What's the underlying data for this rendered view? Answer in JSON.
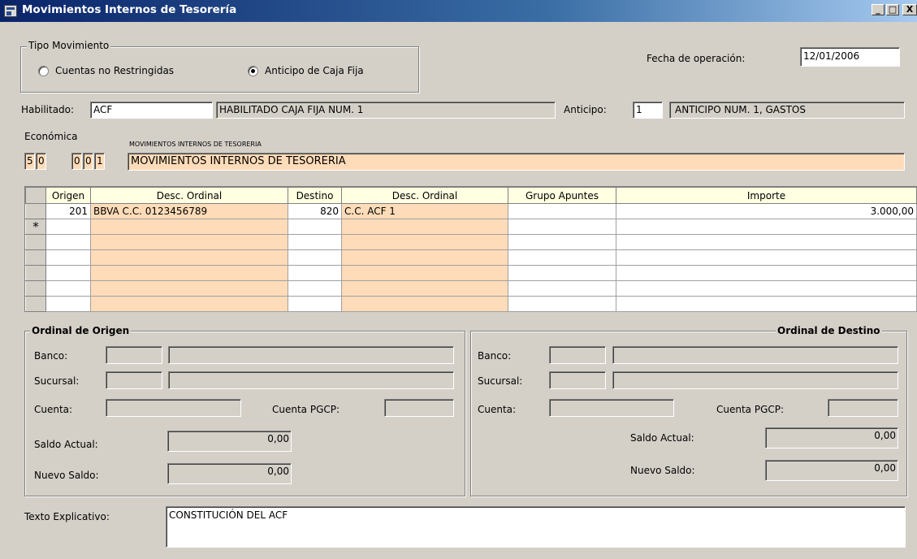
{
  "window": {
    "title": "Movimientos Internos de Tesorería",
    "controls": {
      "minimize": "_",
      "maximize": "□",
      "close": "X"
    }
  },
  "tipo_movimiento": {
    "caption": "Tipo Movimiento",
    "options": [
      {
        "label": "Cuentas no Restringidas",
        "checked": false
      },
      {
        "label": "Anticipo de Caja Fija",
        "checked": true
      }
    ]
  },
  "fecha": {
    "label": "Fecha de operación:",
    "value": "12/01/2006"
  },
  "habilitado": {
    "label": "Habilitado:",
    "code": "ACF",
    "description": "HABILITADO CAJA FIJA NUM. 1"
  },
  "anticipo": {
    "label": "Anticipo:",
    "code": "1",
    "description": "ANTICIPO NUM. 1, GASTOS"
  },
  "economica": {
    "label": "Económica",
    "digits_a": [
      "5",
      "0"
    ],
    "digits_b": [
      "0",
      "0",
      "1"
    ],
    "small_caption": "MOVIMIENTOS INTERNOS DE TESORERIA",
    "description": "MOVIMIENTOS INTERNOS DE TESORERIA"
  },
  "grid": {
    "columns": [
      "Origen",
      "Desc. Ordinal",
      "Destino",
      "Desc. Ordinal",
      "Grupo Apuntes",
      "Importe"
    ],
    "rows": [
      {
        "origen": "201",
        "desc_origen": "BBVA C.C. 0123456789",
        "destino": "820",
        "desc_destino": "C.C. ACF 1",
        "grupo": "",
        "importe": "3.000,00"
      }
    ],
    "new_row_marker": "*"
  },
  "ordinal_origen": {
    "caption": "Ordinal de Origen",
    "banco_label": "Banco:",
    "sucursal_label": "Sucursal:",
    "cuenta_label": "Cuenta:",
    "pgcp_label": "Cuenta PGCP:",
    "saldo_actual_label": "Saldo Actual:",
    "saldo_actual": "0,00",
    "nuevo_saldo_label": "Nuevo Saldo:",
    "nuevo_saldo": "0,00"
  },
  "ordinal_destino": {
    "caption": "Ordinal de Destino",
    "banco_label": "Banco:",
    "sucursal_label": "Sucursal:",
    "cuenta_label": "Cuenta:",
    "pgcp_label": "Cuenta PGCP:",
    "saldo_actual_label": "Saldo Actual:",
    "saldo_actual": "0,00",
    "nuevo_saldo_label": "Nuevo Saldo:",
    "nuevo_saldo": "0,00"
  },
  "texto_explicativo": {
    "label": "Texto Explicativo:",
    "value": "CONSTITUCIÓN DEL ACF"
  },
  "colors": {
    "form_bg": "#d4d0c8",
    "peach": "#ffdcb9",
    "header_yellow": "#ffffe1",
    "title_blue": "#0a246a"
  }
}
